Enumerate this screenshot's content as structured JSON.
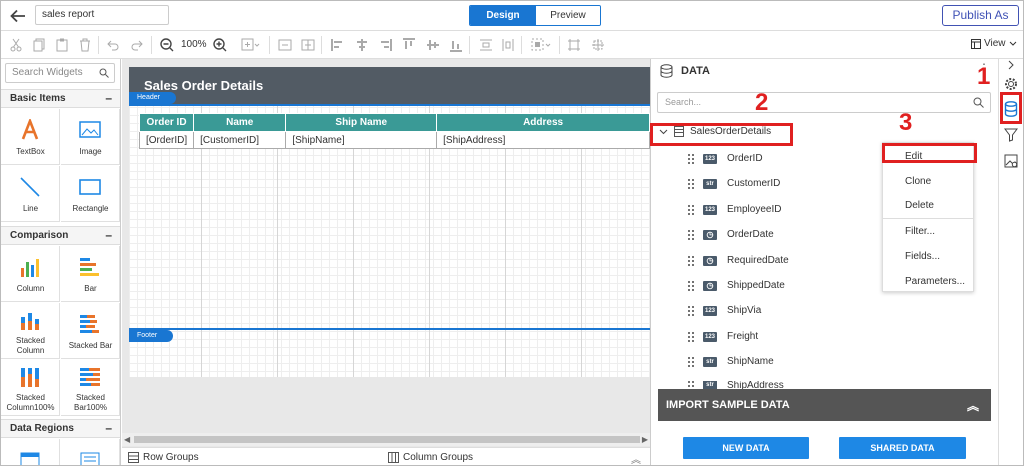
{
  "topbar": {
    "report_name": "sales report",
    "mode_design": "Design",
    "mode_preview": "Preview",
    "publish_label": "Publish As"
  },
  "toolbar": {
    "zoom": "100%",
    "view_label": "View"
  },
  "left_panel": {
    "search_placeholder": "Search Widgets",
    "categories": [
      {
        "label": "Basic Items",
        "toggle": "–"
      },
      {
        "label": "Comparison",
        "toggle": "–"
      },
      {
        "label": "Data Regions",
        "toggle": "–"
      }
    ],
    "widgets": [
      {
        "label": "TextBox"
      },
      {
        "label": "Image"
      },
      {
        "label": "Line"
      },
      {
        "label": "Rectangle"
      },
      {
        "label": "Column"
      },
      {
        "label": "Bar"
      },
      {
        "label": "Stacked Column",
        "line1": "Stacked",
        "line2": "Column"
      },
      {
        "label": "Stacked Bar"
      },
      {
        "label": "Stacked Column100%",
        "line1": "Stacked",
        "line2": "Column100%"
      },
      {
        "label": "Stacked Bar100%",
        "line1": "Stacked",
        "line2": "Bar100%"
      }
    ]
  },
  "designer": {
    "header_title": "Sales Order Details",
    "header_tag": "Header",
    "footer_tag": "Footer",
    "table": {
      "columns": [
        "Order ID",
        "Name",
        "Ship Name",
        "Address"
      ],
      "cells": [
        "[OrderID]",
        "[CustomerID]",
        "[ShipName]",
        "[ShipAddress]"
      ]
    },
    "row_groups": "Row Groups",
    "column_groups": "Column Groups"
  },
  "data_panel": {
    "title": "DATA",
    "menu_glyph": "⋮",
    "search_placeholder": "Search...",
    "dataset": "SalesOrderDetails",
    "fields": [
      {
        "name": "OrderID",
        "type": "123"
      },
      {
        "name": "CustomerID",
        "type": "str"
      },
      {
        "name": "EmployeeID",
        "type": "123"
      },
      {
        "name": "OrderDate",
        "type": "date"
      },
      {
        "name": "RequiredDate",
        "type": "date"
      },
      {
        "name": "ShippedDate",
        "type": "date"
      },
      {
        "name": "ShipVia",
        "type": "123"
      },
      {
        "name": "Freight",
        "type": "123"
      },
      {
        "name": "ShipName",
        "type": "str"
      },
      {
        "name": "ShipAddress",
        "type": "str"
      }
    ],
    "context_menu": [
      "Edit",
      "Clone",
      "Delete",
      "Filter...",
      "Fields...",
      "Parameters..."
    ],
    "import_label": "IMPORT SAMPLE DATA",
    "new_data": "NEW DATA",
    "shared_data": "SHARED DATA"
  },
  "annotations": [
    "1",
    "2",
    "3"
  ],
  "colors": {
    "accent": "#1976d2",
    "header_band": "#525b64",
    "table_header": "#3a9a96",
    "annotation_red": "#e02020",
    "button_blue": "#1e88e5"
  }
}
